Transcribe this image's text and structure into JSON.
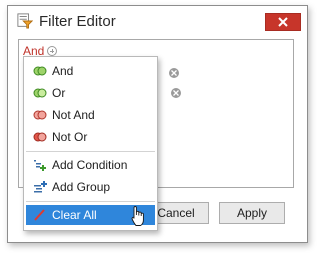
{
  "window": {
    "title": "Filter Editor",
    "close_icon": "close-icon",
    "app_icon": "filter-editor-icon"
  },
  "editor": {
    "root_group_operator": "And"
  },
  "buttons": {
    "cancel_label": "Cancel",
    "apply_label": "Apply"
  },
  "context_menu": {
    "items": [
      {
        "label": "And",
        "icon": "and-group-icon"
      },
      {
        "label": "Or",
        "icon": "or-group-icon"
      },
      {
        "label": "Not And",
        "icon": "not-and-group-icon"
      },
      {
        "label": "Not Or",
        "icon": "not-or-group-icon"
      },
      {
        "label": "Add Condition",
        "icon": "add-condition-icon"
      },
      {
        "label": "Add Group",
        "icon": "add-group-icon"
      },
      {
        "label": "Clear All",
        "icon": "clear-all-icon"
      }
    ],
    "selected_index": 6
  },
  "colors": {
    "accent": "#2f86db",
    "close_button": "#c7352a",
    "operator_link": "#c0332a"
  }
}
